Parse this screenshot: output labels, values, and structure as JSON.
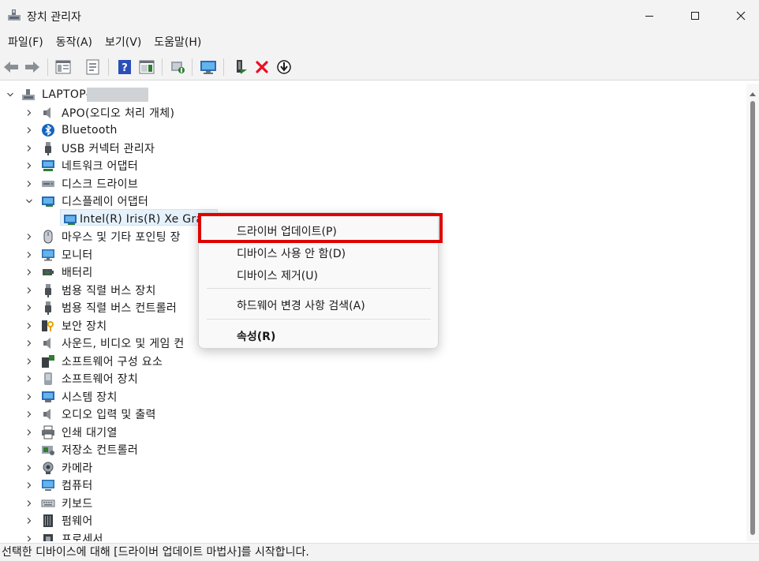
{
  "window": {
    "title": "장치 관리자",
    "controls": {
      "minimize": "minimize",
      "maximize": "maximize",
      "close": "close"
    }
  },
  "menubar": {
    "items": [
      {
        "label": "파일(F)"
      },
      {
        "label": "동작(A)"
      },
      {
        "label": "보기(V)"
      },
      {
        "label": "도움말(H)"
      }
    ]
  },
  "toolbar": {
    "buttons": [
      {
        "icon": "back-arrow-icon"
      },
      {
        "icon": "forward-arrow-icon"
      },
      {
        "icon": "show-hide-console-tree-icon"
      },
      {
        "icon": "properties-icon"
      },
      {
        "icon": "help-icon"
      },
      {
        "icon": "action-pane-icon"
      },
      {
        "icon": "scan-hardware-changes-icon"
      },
      {
        "icon": "monitor-icon"
      },
      {
        "icon": "update-driver-icon"
      },
      {
        "icon": "uninstall-device-icon"
      },
      {
        "icon": "disable-device-icon"
      }
    ]
  },
  "tree": {
    "root": {
      "label": "LAPTOP-",
      "expanded": true
    },
    "nodes": [
      {
        "label": "APO(오디오 처리 개체)",
        "icon": "speaker-icon"
      },
      {
        "label": "Bluetooth",
        "icon": "bluetooth-icon"
      },
      {
        "label": "USB 커넥터 관리자",
        "icon": "usb-icon"
      },
      {
        "label": "네트워크 어댑터",
        "icon": "network-adapter-icon"
      },
      {
        "label": "디스크 드라이브",
        "icon": "disk-drive-icon"
      },
      {
        "label": "디스플레이 어댑터",
        "icon": "display-adapter-icon",
        "expanded": true,
        "children": [
          {
            "label": "Intel(R) Iris(R) Xe Graph",
            "icon": "display-adapter-icon",
            "selected": true
          }
        ]
      },
      {
        "label": "마우스 및 기타 포인팅 장",
        "icon": "mouse-icon"
      },
      {
        "label": "모니터",
        "icon": "monitor-icon"
      },
      {
        "label": "배터리",
        "icon": "battery-icon"
      },
      {
        "label": "범용 직렬 버스 장치",
        "icon": "usb-icon"
      },
      {
        "label": "범용 직렬 버스 컨트롤러",
        "icon": "usb-icon"
      },
      {
        "label": "보안 장치",
        "icon": "security-key-icon"
      },
      {
        "label": "사운드, 비디오 및 게임 컨",
        "icon": "speaker-icon"
      },
      {
        "label": "소프트웨어 구성 요소",
        "icon": "puzzle-icon"
      },
      {
        "label": "소프트웨어 장치",
        "icon": "software-device-icon"
      },
      {
        "label": "시스템 장치",
        "icon": "system-device-icon"
      },
      {
        "label": "오디오 입력 및 출력",
        "icon": "speaker-icon"
      },
      {
        "label": "인쇄 대기열",
        "icon": "printer-icon"
      },
      {
        "label": "저장소 컨트롤러",
        "icon": "storage-controller-icon"
      },
      {
        "label": "카메라",
        "icon": "camera-icon"
      },
      {
        "label": "컴퓨터",
        "icon": "computer-icon"
      },
      {
        "label": "키보드",
        "icon": "keyboard-icon"
      },
      {
        "label": "펌웨어",
        "icon": "firmware-icon"
      },
      {
        "label": "프로세서",
        "icon": "processor-icon"
      }
    ]
  },
  "context_menu": {
    "items": [
      {
        "label": "드라이버 업데이트(P)",
        "highlighted": true
      },
      {
        "label": "디바이스 사용 안 함(D)"
      },
      {
        "label": "디바이스 제거(U)"
      },
      {
        "label": "하드웨어 변경 사항 검색(A)"
      },
      {
        "label": "속성(R)",
        "bold": true
      }
    ]
  },
  "status_bar": {
    "text": "선택한 디바이스에 대해 [드라이버 업데이트 마법사]를 시작합니다."
  },
  "colors": {
    "chrome": "#f3f3f3",
    "selection": "#e5f1fb",
    "highlight_border": "#e00000",
    "uninstall_red": "#e81123"
  }
}
